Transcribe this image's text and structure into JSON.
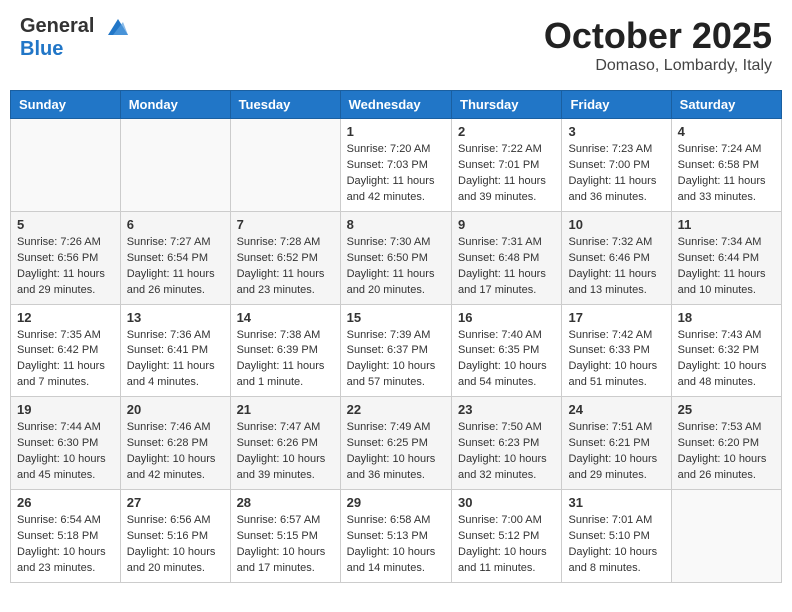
{
  "header": {
    "logo_general": "General",
    "logo_blue": "Blue",
    "month": "October 2025",
    "location": "Domaso, Lombardy, Italy"
  },
  "days_of_week": [
    "Sunday",
    "Monday",
    "Tuesday",
    "Wednesday",
    "Thursday",
    "Friday",
    "Saturday"
  ],
  "weeks": [
    [
      {
        "day": "",
        "info": ""
      },
      {
        "day": "",
        "info": ""
      },
      {
        "day": "",
        "info": ""
      },
      {
        "day": "1",
        "info": "Sunrise: 7:20 AM\nSunset: 7:03 PM\nDaylight: 11 hours and 42 minutes."
      },
      {
        "day": "2",
        "info": "Sunrise: 7:22 AM\nSunset: 7:01 PM\nDaylight: 11 hours and 39 minutes."
      },
      {
        "day": "3",
        "info": "Sunrise: 7:23 AM\nSunset: 7:00 PM\nDaylight: 11 hours and 36 minutes."
      },
      {
        "day": "4",
        "info": "Sunrise: 7:24 AM\nSunset: 6:58 PM\nDaylight: 11 hours and 33 minutes."
      }
    ],
    [
      {
        "day": "5",
        "info": "Sunrise: 7:26 AM\nSunset: 6:56 PM\nDaylight: 11 hours and 29 minutes."
      },
      {
        "day": "6",
        "info": "Sunrise: 7:27 AM\nSunset: 6:54 PM\nDaylight: 11 hours and 26 minutes."
      },
      {
        "day": "7",
        "info": "Sunrise: 7:28 AM\nSunset: 6:52 PM\nDaylight: 11 hours and 23 minutes."
      },
      {
        "day": "8",
        "info": "Sunrise: 7:30 AM\nSunset: 6:50 PM\nDaylight: 11 hours and 20 minutes."
      },
      {
        "day": "9",
        "info": "Sunrise: 7:31 AM\nSunset: 6:48 PM\nDaylight: 11 hours and 17 minutes."
      },
      {
        "day": "10",
        "info": "Sunrise: 7:32 AM\nSunset: 6:46 PM\nDaylight: 11 hours and 13 minutes."
      },
      {
        "day": "11",
        "info": "Sunrise: 7:34 AM\nSunset: 6:44 PM\nDaylight: 11 hours and 10 minutes."
      }
    ],
    [
      {
        "day": "12",
        "info": "Sunrise: 7:35 AM\nSunset: 6:42 PM\nDaylight: 11 hours and 7 minutes."
      },
      {
        "day": "13",
        "info": "Sunrise: 7:36 AM\nSunset: 6:41 PM\nDaylight: 11 hours and 4 minutes."
      },
      {
        "day": "14",
        "info": "Sunrise: 7:38 AM\nSunset: 6:39 PM\nDaylight: 11 hours and 1 minute."
      },
      {
        "day": "15",
        "info": "Sunrise: 7:39 AM\nSunset: 6:37 PM\nDaylight: 10 hours and 57 minutes."
      },
      {
        "day": "16",
        "info": "Sunrise: 7:40 AM\nSunset: 6:35 PM\nDaylight: 10 hours and 54 minutes."
      },
      {
        "day": "17",
        "info": "Sunrise: 7:42 AM\nSunset: 6:33 PM\nDaylight: 10 hours and 51 minutes."
      },
      {
        "day": "18",
        "info": "Sunrise: 7:43 AM\nSunset: 6:32 PM\nDaylight: 10 hours and 48 minutes."
      }
    ],
    [
      {
        "day": "19",
        "info": "Sunrise: 7:44 AM\nSunset: 6:30 PM\nDaylight: 10 hours and 45 minutes."
      },
      {
        "day": "20",
        "info": "Sunrise: 7:46 AM\nSunset: 6:28 PM\nDaylight: 10 hours and 42 minutes."
      },
      {
        "day": "21",
        "info": "Sunrise: 7:47 AM\nSunset: 6:26 PM\nDaylight: 10 hours and 39 minutes."
      },
      {
        "day": "22",
        "info": "Sunrise: 7:49 AM\nSunset: 6:25 PM\nDaylight: 10 hours and 36 minutes."
      },
      {
        "day": "23",
        "info": "Sunrise: 7:50 AM\nSunset: 6:23 PM\nDaylight: 10 hours and 32 minutes."
      },
      {
        "day": "24",
        "info": "Sunrise: 7:51 AM\nSunset: 6:21 PM\nDaylight: 10 hours and 29 minutes."
      },
      {
        "day": "25",
        "info": "Sunrise: 7:53 AM\nSunset: 6:20 PM\nDaylight: 10 hours and 26 minutes."
      }
    ],
    [
      {
        "day": "26",
        "info": "Sunrise: 6:54 AM\nSunset: 5:18 PM\nDaylight: 10 hours and 23 minutes."
      },
      {
        "day": "27",
        "info": "Sunrise: 6:56 AM\nSunset: 5:16 PM\nDaylight: 10 hours and 20 minutes."
      },
      {
        "day": "28",
        "info": "Sunrise: 6:57 AM\nSunset: 5:15 PM\nDaylight: 10 hours and 17 minutes."
      },
      {
        "day": "29",
        "info": "Sunrise: 6:58 AM\nSunset: 5:13 PM\nDaylight: 10 hours and 14 minutes."
      },
      {
        "day": "30",
        "info": "Sunrise: 7:00 AM\nSunset: 5:12 PM\nDaylight: 10 hours and 11 minutes."
      },
      {
        "day": "31",
        "info": "Sunrise: 7:01 AM\nSunset: 5:10 PM\nDaylight: 10 hours and 8 minutes."
      },
      {
        "day": "",
        "info": ""
      }
    ]
  ]
}
